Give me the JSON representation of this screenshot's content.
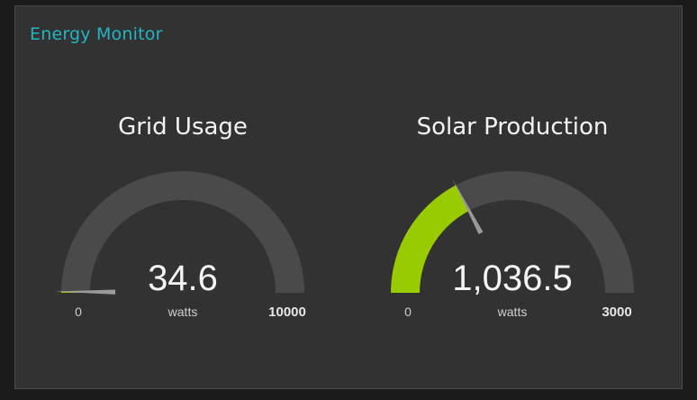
{
  "panel": {
    "title": "Energy Monitor"
  },
  "colors": {
    "accent": "#22b5c3",
    "track": "#4a4a4a",
    "fill": "#99cc00",
    "needle": "#9a9a9a"
  },
  "gauges": [
    {
      "title": "Grid Usage",
      "value": 34.6,
      "value_text": "34.6",
      "unit": "watts",
      "min": 0,
      "max": 10000,
      "min_text": "0",
      "max_text": "10000"
    },
    {
      "title": "Solar Production",
      "value": 1036.5,
      "value_text": "1,036.5",
      "unit": "watts",
      "min": 0,
      "max": 3000,
      "min_text": "0",
      "max_text": "3000"
    }
  ]
}
